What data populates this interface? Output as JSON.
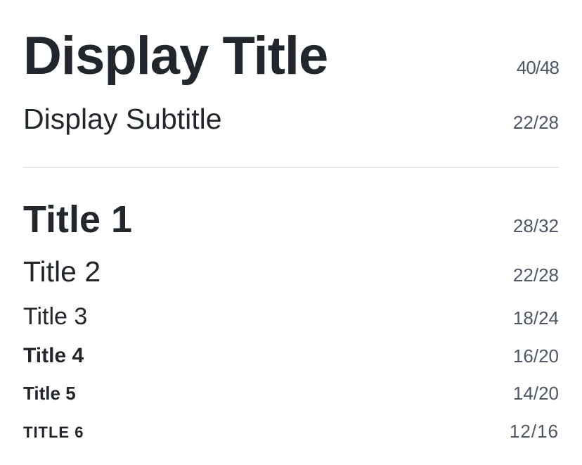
{
  "display": {
    "title": {
      "label": "Display Title",
      "spec": "40/48"
    },
    "subtitle": {
      "label": "Display Subtitle",
      "spec": "22/28"
    }
  },
  "titles": [
    {
      "label": "Title 1",
      "spec": "28/32"
    },
    {
      "label": "Title 2",
      "spec": "22/28"
    },
    {
      "label": "Title 3",
      "spec": "18/24"
    },
    {
      "label": "Title 4",
      "spec": "16/20"
    },
    {
      "label": "Title 5",
      "spec": "14/20"
    },
    {
      "label": "TITLE 6",
      "spec": "12/16"
    }
  ],
  "colors": {
    "text": "#22262d",
    "meta": "#4e5766",
    "divider": "#e6e8eb",
    "background": "#ffffff"
  }
}
